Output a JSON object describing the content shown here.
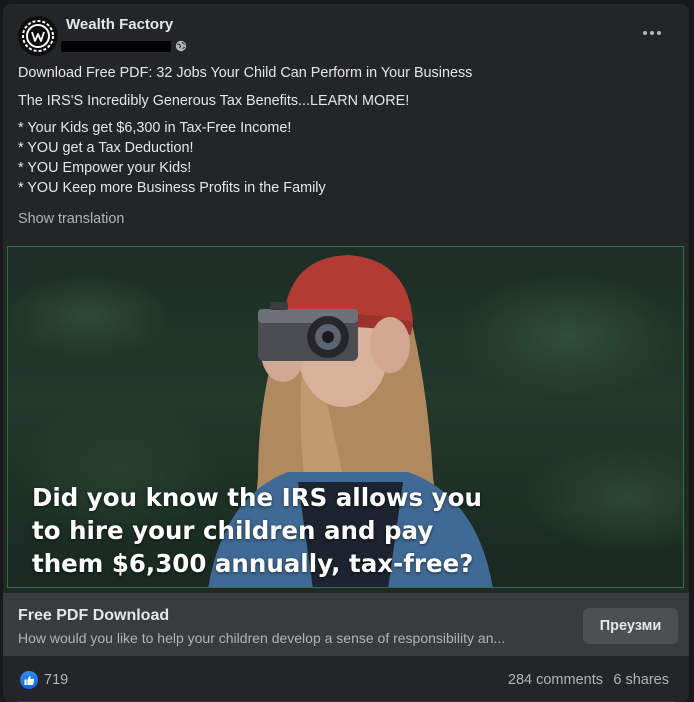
{
  "post": {
    "page_name": "Wealth Factory",
    "privacy_icon": "globe-icon",
    "more_icon": "more-options-icon",
    "headline": "Download Free PDF: 32 Jobs Your Child Can Perform in Your Business",
    "tagline": "The IRS'S Incredibly Generous Tax Benefits...LEARN MORE!",
    "bullets": [
      "* Your Kids get $6,300 in Tax-Free Income!",
      "* YOU get a Tax Deduction!",
      "* YOU Empower your Kids!",
      "* YOU Keep more Business Profits in the Family"
    ],
    "show_translation": "Show translation"
  },
  "media": {
    "overlay_lines": [
      "Did you know the IRS allows you",
      "to hire your children and pay",
      "them $6,300 annually, tax-free?"
    ]
  },
  "link_preview": {
    "title": "Free PDF Download",
    "description": "How would you like to help your children develop a sense of responsibility an...",
    "cta_label": "Преузми"
  },
  "engagement": {
    "reaction_icon": "like-icon",
    "reactions": "719",
    "comments": "284 comments",
    "shares": "6 shares"
  },
  "colors": {
    "card_bg": "#242526",
    "page_bg": "#18191a",
    "link_bar_bg": "#3a3b3c",
    "primary_text": "#e4e6eb",
    "secondary_text": "#b0b3b8",
    "like_blue": "#1877f2"
  }
}
